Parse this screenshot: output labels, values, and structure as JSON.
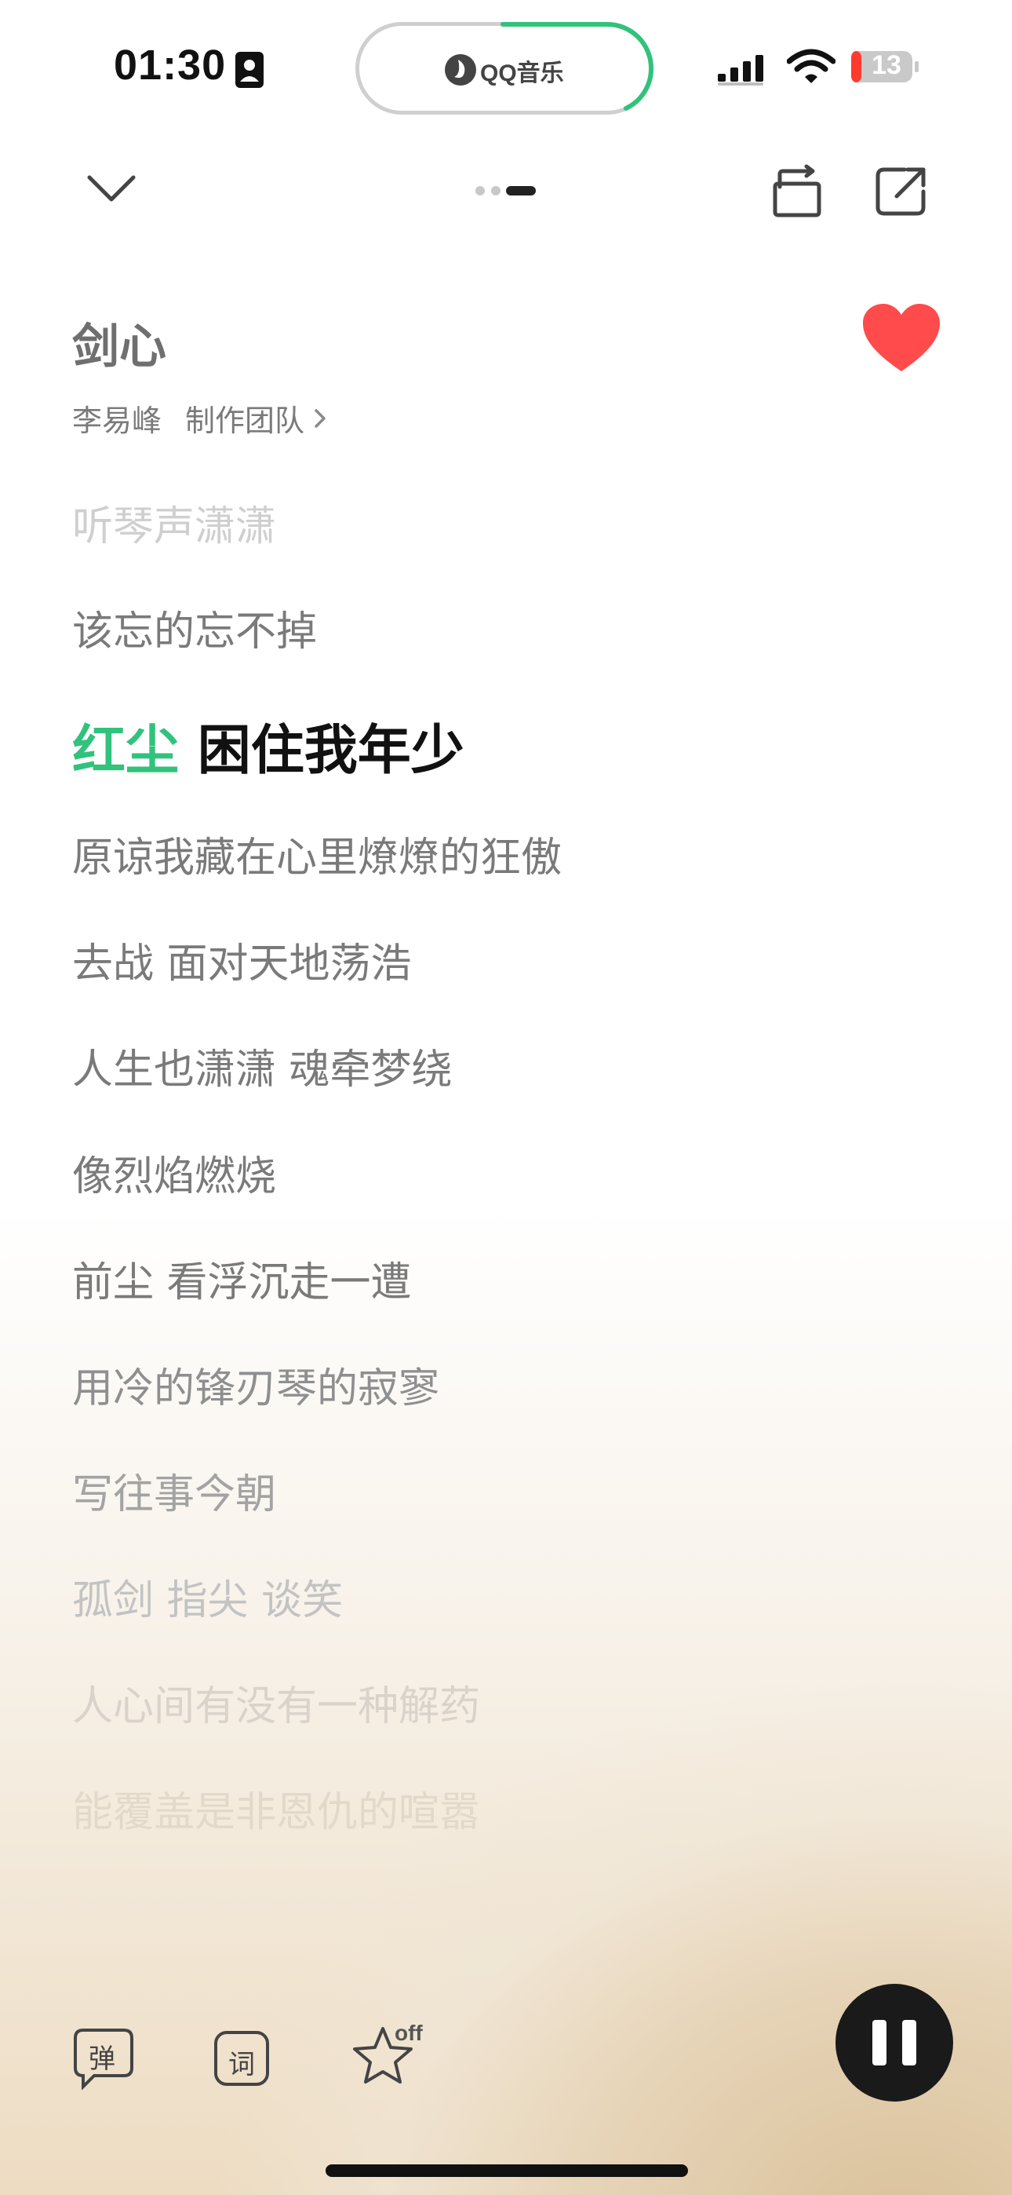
{
  "status_bar": {
    "time": "01:30",
    "island_app_label": "QQ音乐",
    "battery_level": "13",
    "battery_color": "#ff3b30",
    "island_progress_color": "#31c27c"
  },
  "header": {
    "collapse_icon": "chevron-down-icon",
    "page_indicator_icon": "page-dots-icon",
    "loop_icon": "repeat-icon",
    "share_icon": "share-icon"
  },
  "song": {
    "title": "剑心",
    "artist": "李易峰",
    "credits_link": "制作团队",
    "liked": true,
    "like_color": "#ff4b4b"
  },
  "lyrics": {
    "lines_before": [
      "听琴声潇潇",
      "该忘的忘不掉"
    ],
    "current": {
      "highlighted": "红尘",
      "rest": " 困住我年少"
    },
    "lines_after": [
      "原谅我藏在心里燎燎的狂傲",
      "去战 面对天地荡浩",
      "人生也潇潇 魂牵梦绕",
      "像烈焰燃烧",
      "前尘 看浮沉走一遭",
      "用冷的锋刃琴的寂寥",
      "写往事今朝",
      "孤剑 指尖 谈笑",
      "人心间有没有一种解药",
      "能覆盖是非恩仇的喧嚣"
    ],
    "highlight_color": "#31c27c"
  },
  "controls": {
    "danmu_label": "弹",
    "lyric_label": "词",
    "star_state": "off",
    "play_state": "playing"
  }
}
